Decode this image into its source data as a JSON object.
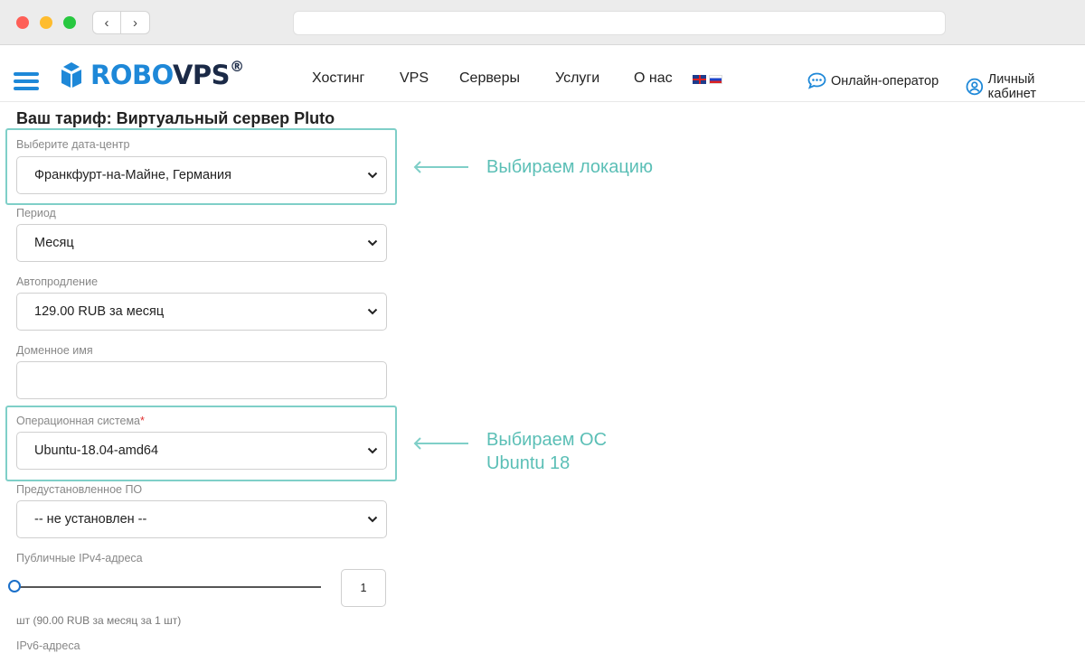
{
  "site": {
    "logo": {
      "part1": "ROBO",
      "part2": "VPS",
      "mark": "®"
    },
    "nav": [
      "Хостинг",
      "VPS",
      "Серверы",
      "Услуги",
      "О нас"
    ],
    "languages": [
      "en",
      "ru"
    ],
    "operator_label": "Онлайн-оператор",
    "account_label": "Личный кабинет"
  },
  "page": {
    "title": "Ваш тариф: Виртуальный сервер Pluto"
  },
  "form": {
    "datacenter": {
      "label": "Выберите дата-центр",
      "value": "Франкфурт-на-Майне, Германия"
    },
    "period": {
      "label": "Период",
      "value": "Месяц"
    },
    "autorenew": {
      "label": "Автопродление",
      "value": "129.00 RUB за месяц"
    },
    "domain": {
      "label": "Доменное имя",
      "value": ""
    },
    "os": {
      "label": "Операционная система",
      "required_mark": "*",
      "value": "Ubuntu-18.04-amd64"
    },
    "preinstalled": {
      "label": "Предустановленное ПО",
      "value": "-- не установлен --"
    },
    "ipv4": {
      "label": "Публичные IPv4-адреса",
      "value": "1",
      "slider_level": 0,
      "note": "шт (90.00 RUB за месяц за 1 шт)"
    },
    "ipv6": {
      "label": "IPv6-адреса"
    }
  },
  "annotations": {
    "location_note": "Выбираем локацию",
    "os_note_line1": "Выбираем ОС",
    "os_note_line2": "Ubuntu 18"
  },
  "colors": {
    "brand_blue": "#1e88d8",
    "brand_dark": "#1b2a47",
    "highlight": "#7fcfc8",
    "annotation_text": "#5bbfb6",
    "required": "#e03030"
  }
}
